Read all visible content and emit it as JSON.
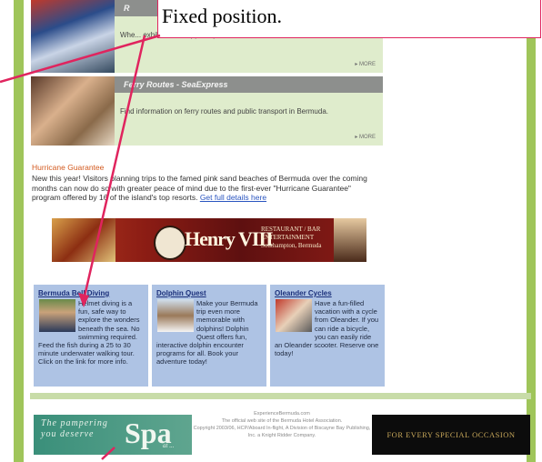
{
  "colors": {
    "accent_green": "#9fc55a",
    "promo_bg": "#dfeccc",
    "column_bg": "#aec3e4",
    "arrow": "#e0245e",
    "hurricane_title": "#d35a1f",
    "link": "#2a55c0"
  },
  "promos": [
    {
      "bar_title": "R",
      "text": "Whe... exhibits all wrapped up in one?",
      "more": "▸ MORE"
    },
    {
      "bar_title": "Ferry Routes - SeaExpress",
      "text": "Find information on ferry routes and public transport in Bermuda.",
      "more": "▸ MORE"
    }
  ],
  "hurricane": {
    "title": "Hurricane Guarantee",
    "body": "New this year! Visitors planning trips to the famed pink sand beaches of Bermuda over the coming months can now do so with greater peace of mind due to the first-ever \"Hurricane Guarantee\" program offered by 16 of the island's top resorts.",
    "link": "Get full details here"
  },
  "henry_banner": {
    "name": "Henry VIII",
    "line1": "RESTAURANT / BAR",
    "line2": "ENTERTAINMENT",
    "line3": "Southampton, Bermuda"
  },
  "columns": [
    {
      "title": "Bermuda Bell Diving",
      "body": "Helmet diving is a fun, safe way to explore the wonders beneath the sea. No swimming required. Feed the fish during a 25 to 30 minute underwater walking tour. Click on the link for more info."
    },
    {
      "title": "Dolphin Quest",
      "body": "Make your Bermuda trip even more memorable with dolphins! Dolphin Quest offers fun, interactive dolphin encounter programs for all. Book your adventure today!"
    },
    {
      "title": "Oleander Cycles",
      "body": "Have a fun-filled vacation with a cycle from Oleander. If you can ride a bicycle, you can easily ride an Oleander scooter. Reserve one today!"
    }
  ],
  "spa_ad": {
    "tagline1": "The pampering",
    "tagline2": "you deserve",
    "word": "Spa",
    "sub": "at ..."
  },
  "footer": {
    "site": "ExperienceBermuda.com",
    "line": "The official web site of the Bermuda Hotel Association.",
    "copyright": "Copyright 2003/06, HCP/Aboard In-flight, A Division of Biscayne Bay Publishing, Inc. a Knight Ridder Company."
  },
  "occasion_ad": {
    "text": "FOR EVERY SPECIAL OCCASION"
  },
  "callout": {
    "text": "Fixed position."
  }
}
